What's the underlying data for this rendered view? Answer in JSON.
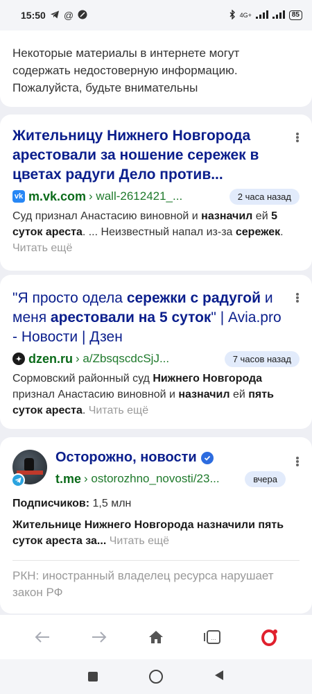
{
  "status": {
    "time": "15:50",
    "network": "4G+",
    "battery": "85"
  },
  "warning": {
    "text": "Некоторые материалы в интернете могут содержать недостоверную информацию. Пожалуйста, будьте внимательны"
  },
  "results": [
    {
      "title": "Жительницу Нижнего Новгорода арестовали за ношение сережек в цветах радуги Дело против...",
      "domain": "m.vk.com",
      "path": "› wall-2612421_...",
      "time": "2 часа назад",
      "snippet_parts": [
        "Суд признал Анастасию виновной и ",
        "назначил",
        " ей ",
        "5 суток ареста",
        ". ... Неизвестный напал из-за ",
        "сережек",
        ". "
      ],
      "more": "Читать ещё"
    },
    {
      "title_parts": [
        "\"Я просто одела ",
        "сережки с радугой",
        " и меня ",
        "арестовали на 5 суток",
        "\" | Avia.pro - Новости | Дзен"
      ],
      "domain": "dzen.ru",
      "path": "› a/ZbsqscdcSjJ...",
      "time": "7 часов назад",
      "snippet_parts": [
        "Сормовский районный суд ",
        "Нижнего Новгорода",
        " признал Анастасию виновной и ",
        "назначил",
        " ей ",
        "пять суток ареста",
        ". "
      ],
      "more": "Читать ещё"
    }
  ],
  "channel": {
    "title": "Осторожно, новости",
    "domain": "t.me",
    "path": "› ostorozhno_novosti/23...",
    "time": "вчера",
    "subs_label": "Подписчиков:",
    "subs_value": " 1,5 млн",
    "post": "Жительнице Нижнего Новгорода назначили пять суток ареста за...",
    "more": " Читать ещё",
    "rkn": "РКН: иностранный владелец ресурса нарушает закон РФ"
  },
  "icons": {
    "nav": [
      "back-arrow-icon",
      "forward-arrow-icon",
      "home-icon",
      "tabs-icon",
      "opera-menu-icon"
    ],
    "accent": "#0a1e8c",
    "green": "#1f7a2c",
    "opera_red": "#e0202d"
  }
}
